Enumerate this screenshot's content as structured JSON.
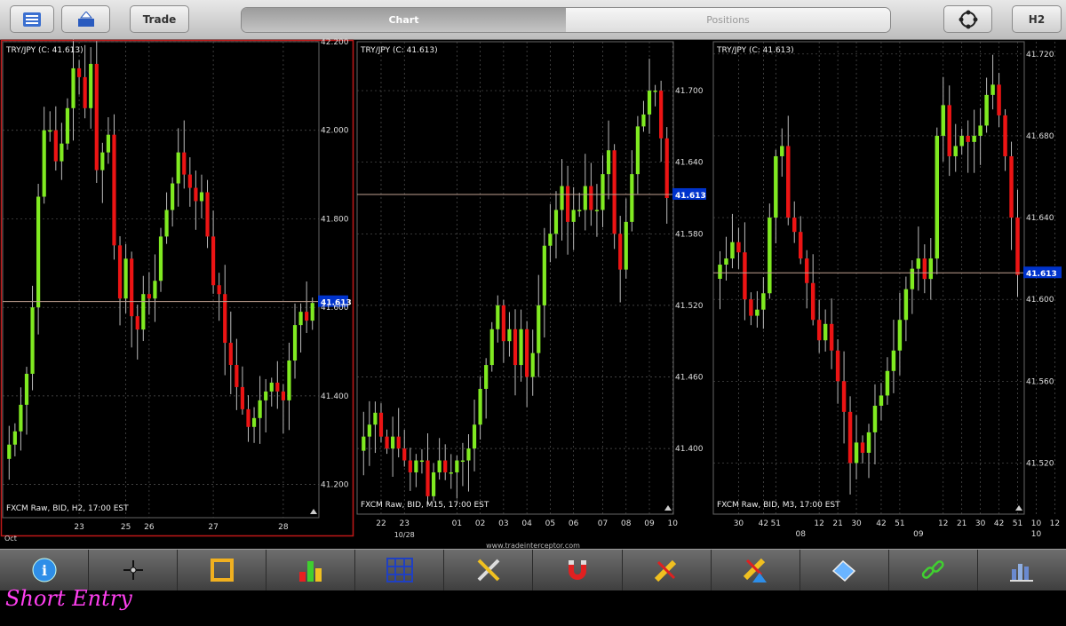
{
  "toolbar": {
    "trade_label": "Trade",
    "tabs": [
      "Chart",
      "Positions"
    ],
    "h2_label": "H2"
  },
  "watermark": "www.tradeinterceptor.com",
  "caption": "Short Entry",
  "bottom_icons": [
    "info-icon",
    "crosshair-icon",
    "ruler-icon",
    "bar-chart-icon",
    "grid-icon",
    "tools-icon",
    "magnet-icon",
    "pencil-icon",
    "pencil-alert-icon",
    "eraser-icon",
    "link-icon",
    "share-icon"
  ],
  "colors": {
    "up": "#80ea21",
    "down": "#ec1414",
    "priceLine": "#c0a090",
    "priceTag": "#0033cc",
    "activeBorder": "#c01818"
  },
  "chart_data": [
    {
      "type": "candlestick",
      "title": "TRY/JPY (C: 41.613)",
      "footer": "FXCM Raw, BID, H2, 17:00 EST",
      "current_price": 41.613,
      "price_tag": "41.613",
      "ylim": [
        41.125,
        42.2
      ],
      "y_ticks": [
        {
          "v": 42.2,
          "t": "42.200"
        },
        {
          "v": 42.0,
          "t": "42.000"
        },
        {
          "v": 41.8,
          "t": "41.800"
        },
        {
          "v": 41.6,
          "t": "41.600"
        },
        {
          "v": 41.4,
          "t": "41.400"
        },
        {
          "v": 41.2,
          "t": "41.200"
        }
      ],
      "x_ticks": [
        {
          "i": 12,
          "t": "23"
        },
        {
          "i": 20,
          "t": "25"
        },
        {
          "i": 24,
          "t": "26"
        },
        {
          "i": 35,
          "t": "27"
        },
        {
          "i": 47,
          "t": "28"
        }
      ],
      "x_sub": "Oct",
      "closes": [
        41.29,
        41.32,
        41.38,
        41.45,
        41.6,
        41.85,
        42.0,
        42.0,
        41.93,
        41.97,
        42.05,
        42.14,
        42.12,
        42.05,
        42.15,
        41.91,
        41.95,
        41.99,
        41.74,
        41.62,
        41.71,
        41.58,
        41.55,
        41.63,
        41.62,
        41.66,
        41.76,
        41.82,
        41.88,
        41.95,
        41.9,
        41.87,
        41.84,
        41.86,
        41.76,
        41.65,
        41.63,
        41.52,
        41.47,
        41.42,
        41.37,
        41.33,
        41.35,
        41.39,
        41.41,
        41.43,
        41.41,
        41.39,
        41.48,
        41.56,
        41.59,
        41.57,
        41.61
      ]
    },
    {
      "type": "candlestick",
      "title": "TRY/JPY (C: 41.613)",
      "footer": "FXCM Raw, BID, M15, 17:00 EST",
      "current_price": 41.613,
      "price_tag": "41.613",
      "ylim": [
        41.345,
        41.741
      ],
      "y_ticks": [
        {
          "v": 41.7,
          "t": "41.700"
        },
        {
          "v": 41.64,
          "t": "41.640"
        },
        {
          "v": 41.58,
          "t": "41.580"
        },
        {
          "v": 41.52,
          "t": "41.520"
        },
        {
          "v": 41.46,
          "t": "41.460"
        },
        {
          "v": 41.4,
          "t": "41.400"
        }
      ],
      "x_ticks": [
        {
          "i": 3,
          "t": "22"
        },
        {
          "i": 7,
          "t": "23"
        },
        {
          "i": 16,
          "t": "01"
        },
        {
          "i": 20,
          "t": "02"
        },
        {
          "i": 24,
          "t": "03"
        },
        {
          "i": 28,
          "t": "04"
        },
        {
          "i": 32,
          "t": "05"
        },
        {
          "i": 36,
          "t": "06"
        },
        {
          "i": 41,
          "t": "07"
        },
        {
          "i": 45,
          "t": "08"
        },
        {
          "i": 49,
          "t": "09"
        },
        {
          "i": 53,
          "t": "10"
        }
      ],
      "x_sub": "10/28",
      "closes": [
        41.41,
        41.42,
        41.43,
        41.41,
        41.4,
        41.41,
        41.4,
        41.39,
        41.38,
        41.39,
        41.39,
        41.36,
        41.38,
        41.39,
        41.38,
        41.38,
        41.39,
        41.39,
        41.4,
        41.42,
        41.45,
        41.47,
        41.5,
        41.52,
        41.49,
        41.5,
        41.47,
        41.5,
        41.46,
        41.48,
        41.52,
        41.57,
        41.58,
        41.6,
        41.62,
        41.59,
        41.6,
        41.6,
        41.62,
        41.6,
        41.6,
        41.63,
        41.65,
        41.58,
        41.55,
        41.59,
        41.63,
        41.67,
        41.68,
        41.7,
        41.7,
        41.66,
        41.61
      ]
    },
    {
      "type": "candlestick",
      "title": "TRY/JPY (C: 41.613)",
      "footer": "FXCM Raw, BID, M3, 17:00 EST",
      "current_price": 41.613,
      "price_tag": "41.613",
      "ylim": [
        41.495,
        41.726
      ],
      "y_ticks": [
        {
          "v": 41.72,
          "t": "41.720"
        },
        {
          "v": 41.68,
          "t": "41.680"
        },
        {
          "v": 41.64,
          "t": "41.640"
        },
        {
          "v": 41.6,
          "t": "41.600"
        },
        {
          "v": 41.56,
          "t": "41.560"
        },
        {
          "v": 41.52,
          "t": "41.520"
        }
      ],
      "x_ticks": [
        {
          "i": 3,
          "t": "30"
        },
        {
          "i": 7,
          "t": "42"
        },
        {
          "i": 9,
          "t": "51"
        },
        {
          "i": 16,
          "t": "12"
        },
        {
          "i": 19,
          "t": "21"
        },
        {
          "i": 22,
          "t": "30"
        },
        {
          "i": 26,
          "t": "42"
        },
        {
          "i": 29,
          "t": "51"
        },
        {
          "i": 36,
          "t": "12"
        },
        {
          "i": 39,
          "t": "21"
        },
        {
          "i": 42,
          "t": "30"
        },
        {
          "i": 45,
          "t": "42"
        },
        {
          "i": 48,
          "t": "51"
        },
        {
          "i": 51,
          "t": "10"
        },
        {
          "i": 54,
          "t": "12"
        }
      ],
      "x_subs": [
        {
          "i": 13,
          "t": "08"
        },
        {
          "i": 32,
          "t": "09"
        },
        {
          "i": 51,
          "t": "10"
        }
      ],
      "closes": [
        41.617,
        41.62,
        41.628,
        41.623,
        41.6,
        41.592,
        41.595,
        41.603,
        41.64,
        41.67,
        41.675,
        41.64,
        41.633,
        41.62,
        41.608,
        41.59,
        41.58,
        41.588,
        41.575,
        41.56,
        41.545,
        41.52,
        41.53,
        41.525,
        41.535,
        41.548,
        41.553,
        41.565,
        41.575,
        41.59,
        41.605,
        41.615,
        41.62,
        41.61,
        41.62,
        41.68,
        41.695,
        41.67,
        41.675,
        41.68,
        41.677,
        41.68,
        41.685,
        41.7,
        41.705,
        41.69,
        41.67,
        41.64,
        41.612
      ]
    }
  ]
}
